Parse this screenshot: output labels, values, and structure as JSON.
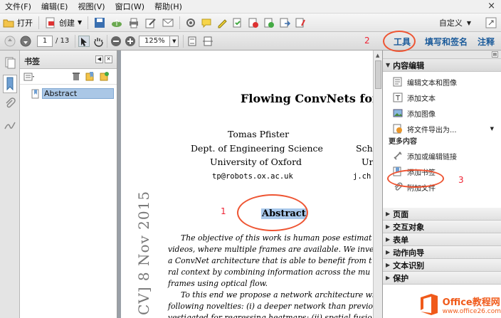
{
  "menubar": {
    "items": [
      "文件(F)",
      "编辑(E)",
      "视图(V)",
      "窗口(W)",
      "帮助(H)"
    ],
    "close": "×"
  },
  "toolbar1": {
    "open_label": "打开",
    "create_label": "创建",
    "customize_label": "自定义"
  },
  "toolbar2": {
    "page_current": "1",
    "page_total": "/ 13",
    "zoom": "125%",
    "tabs": [
      "工具",
      "填写和签名",
      "注释"
    ]
  },
  "bookmarks": {
    "title": "书签",
    "items": [
      "Abstract"
    ]
  },
  "document": {
    "title": "Flowing ConvNets for",
    "author_name": "Tomas Pfister",
    "author_dept": "Dept. of Engineering Science",
    "author_univ": "University of Oxford",
    "author_email": "tp@robots.ox.ac.uk",
    "col2_line1": "Sch",
    "col2_line2": "Ur",
    "col2_email": "j.ch",
    "abstract_heading": "Abstract",
    "arxiv_stamp": "CV]  8 Nov 2015",
    "abstract_lines": [
      "The objective of this work is human pose estimat",
      "videos, where multiple frames are available. We inves",
      "a ConvNet architecture that is able to benefit from t",
      "ral context by combining information across the mu",
      "frames using optical flow.",
      "To this end we propose a network architecture wi",
      "following novelties: (i) a deeper network than previou",
      "vestigated for regressing heatmaps; (ii) spatial fusio"
    ]
  },
  "tools_panel": {
    "content_edit_header": "内容编辑",
    "items": [
      "编辑文本和图像",
      "添加文本",
      "添加图像",
      "将文件导出为..."
    ],
    "more_label": "更多内容",
    "more_items": [
      "添加或编辑链接",
      "添加书签",
      "附加文件"
    ],
    "sections": [
      "页面",
      "交互对象",
      "表单",
      "动作向导",
      "文本识别",
      "保护"
    ]
  },
  "annotations": {
    "one": "1",
    "two": "2",
    "three": "3"
  },
  "watermark": {
    "brand": "Office教程网",
    "url": "www.office26.com"
  },
  "colors": {
    "accent_red": "#e53322",
    "tab_blue": "#1a5a9a",
    "selection": "#a9c9ec",
    "logo_orange": "#f05a1a"
  }
}
